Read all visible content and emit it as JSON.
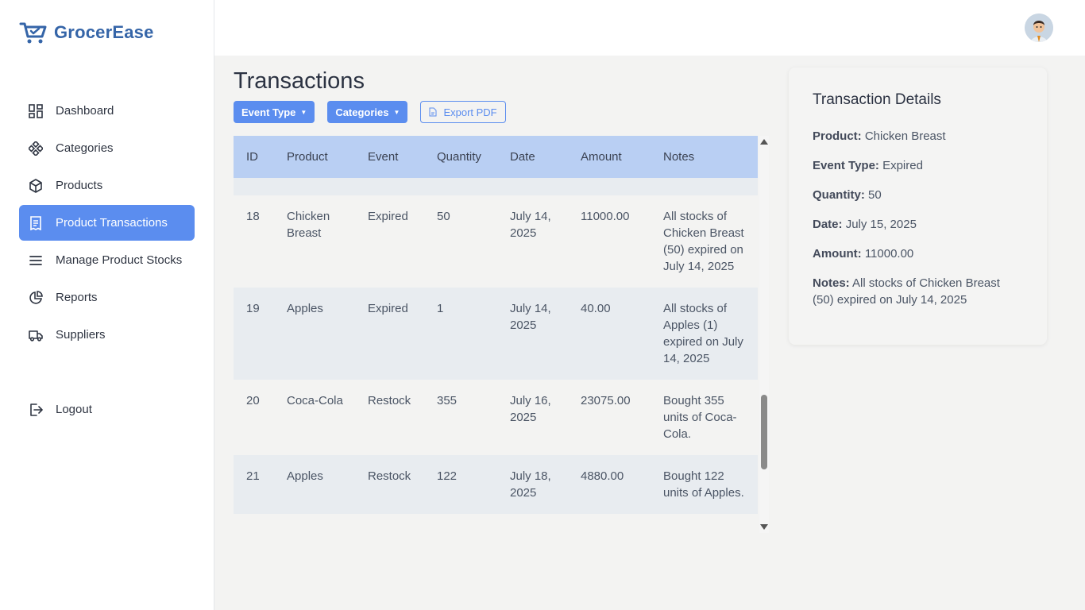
{
  "brand": {
    "name": "GrocerEase"
  },
  "sidebar": {
    "items": [
      {
        "label": "Dashboard",
        "icon": "dashboard-icon"
      },
      {
        "label": "Categories",
        "icon": "categories-icon"
      },
      {
        "label": "Products",
        "icon": "box-icon"
      },
      {
        "label": "Product Transactions",
        "icon": "receipt-icon",
        "active": true
      },
      {
        "label": "Manage Product Stocks",
        "icon": "menu-lines-icon"
      },
      {
        "label": "Reports",
        "icon": "pie-chart-icon"
      },
      {
        "label": "Suppliers",
        "icon": "truck-icon"
      }
    ],
    "logout": "Logout"
  },
  "page": {
    "title": "Transactions"
  },
  "toolbar": {
    "event_type": "Event Type",
    "categories": "Categories",
    "export": "Export PDF"
  },
  "table": {
    "headers": [
      "ID",
      "Product",
      "Event",
      "Quantity",
      "Date",
      "Amount",
      "Notes"
    ],
    "rows": [
      {
        "id": "18",
        "product": "Chicken Breast",
        "event": "Expired",
        "quantity": "50",
        "date": "July 14, 2025",
        "amount": "11000.00",
        "notes": "All stocks of Chicken Breast (50) expired on July 14, 2025"
      },
      {
        "id": "19",
        "product": "Apples",
        "event": "Expired",
        "quantity": "1",
        "date": "July 14, 2025",
        "amount": "40.00",
        "notes": "All stocks of Apples (1) expired on July 14, 2025"
      },
      {
        "id": "20",
        "product": "Coca-Cola",
        "event": "Restock",
        "quantity": "355",
        "date": "July 16, 2025",
        "amount": "23075.00",
        "notes": "Bought 355 units of Coca-Cola."
      },
      {
        "id": "21",
        "product": "Apples",
        "event": "Restock",
        "quantity": "122",
        "date": "July 18, 2025",
        "amount": "4880.00",
        "notes": "Bought 122 units of Apples."
      }
    ]
  },
  "details": {
    "title": "Transaction Details",
    "product_label": "Product:",
    "product": "Chicken Breast",
    "event_label": "Event Type:",
    "event": "Expired",
    "quantity_label": "Quantity:",
    "quantity": "50",
    "date_label": "Date:",
    "date": "July 15, 2025",
    "amount_label": "Amount:",
    "amount": "11000.00",
    "notes_label": "Notes:",
    "notes": "All stocks of Chicken Breast (50) expired on July 14, 2025"
  },
  "colors": {
    "accent": "#5b8def",
    "brand": "#3565a8",
    "table_header": "#b9cff3"
  }
}
